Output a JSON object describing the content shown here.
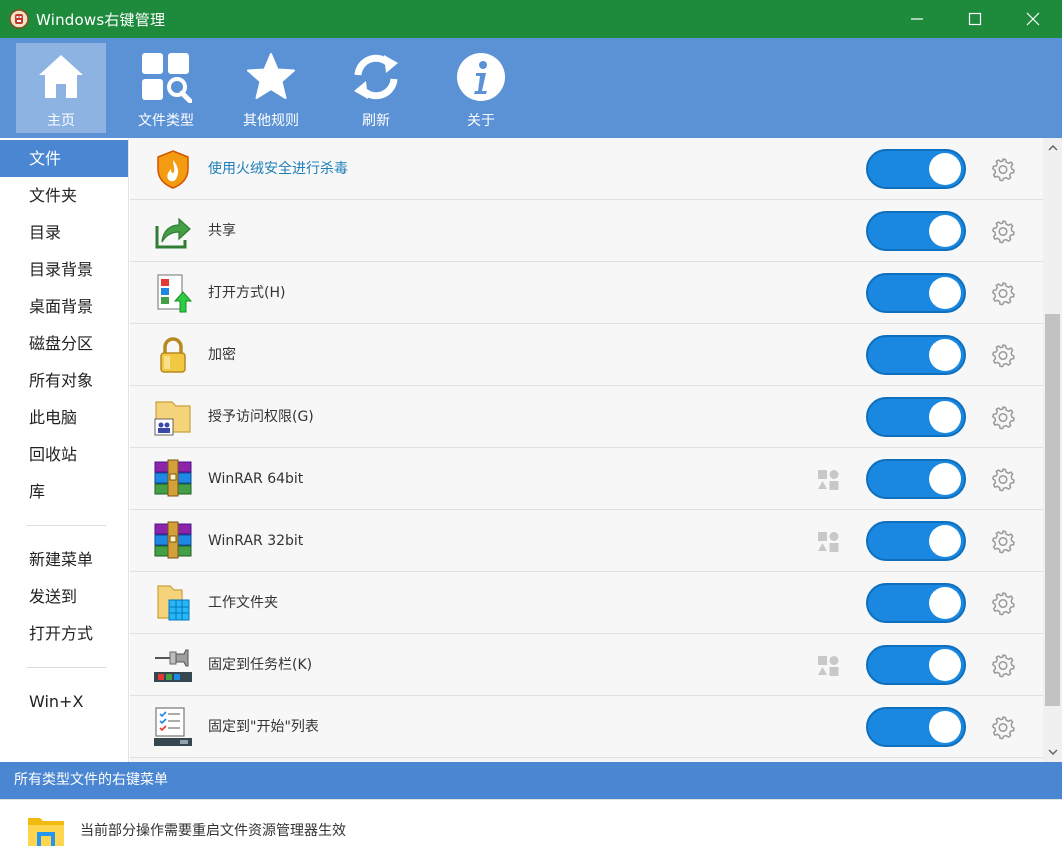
{
  "window": {
    "title": "Windows右键管理",
    "icon": "app-icon"
  },
  "toolbar": {
    "items": [
      {
        "label": "主页",
        "icon": "home-icon",
        "active": true
      },
      {
        "label": "文件类型",
        "icon": "file-types-icon",
        "active": false
      },
      {
        "label": "其他规则",
        "icon": "star-icon",
        "active": false
      },
      {
        "label": "刷新",
        "icon": "refresh-icon",
        "active": false
      },
      {
        "label": "关于",
        "icon": "info-icon",
        "active": false
      }
    ]
  },
  "sidebar": {
    "items": [
      {
        "label": "文件",
        "active": true
      },
      {
        "label": "文件夹"
      },
      {
        "label": "目录"
      },
      {
        "label": "目录背景"
      },
      {
        "label": "桌面背景"
      },
      {
        "label": "磁盘分区"
      },
      {
        "label": "所有对象"
      },
      {
        "label": "此电脑"
      },
      {
        "label": "回收站"
      },
      {
        "label": "库"
      }
    ],
    "items2": [
      {
        "label": "新建菜单"
      },
      {
        "label": "发送到"
      },
      {
        "label": "打开方式"
      }
    ],
    "items3": [
      {
        "label": "Win+X"
      }
    ]
  },
  "list": {
    "rows": [
      {
        "label": "使用火绒安全进行杀毒",
        "icon": "huorong-shield-icon",
        "enabled": true,
        "link": true
      },
      {
        "label": "共享",
        "icon": "share-arrow-icon",
        "enabled": true
      },
      {
        "label": "打开方式(H)",
        "icon": "open-with-icon",
        "enabled": true
      },
      {
        "label": "加密",
        "icon": "padlock-icon",
        "enabled": true
      },
      {
        "label": "授予访问权限(G)",
        "icon": "grant-access-icon",
        "enabled": true
      },
      {
        "label": "WinRAR 64bit",
        "icon": "winrar-books-icon",
        "enabled": true,
        "shell_ext": true
      },
      {
        "label": "WinRAR 32bit",
        "icon": "winrar-books-icon",
        "enabled": true,
        "shell_ext": true
      },
      {
        "label": "工作文件夹",
        "icon": "work-folder-icon",
        "enabled": true
      },
      {
        "label": "固定到任务栏(K)",
        "icon": "pin-taskbar-icon",
        "enabled": true,
        "shell_ext": true
      },
      {
        "label": "固定到\"开始\"列表",
        "icon": "pin-start-icon",
        "enabled": true
      }
    ]
  },
  "status": {
    "text": "所有类型文件的右键菜单"
  },
  "footer": {
    "text": "当前部分操作需要重启文件资源管理器生效",
    "icon": "explorer-folder-icon"
  },
  "colors": {
    "titlebar": "#1e8a3c",
    "toolbar": "#5b92d6",
    "accent": "#4a86d1",
    "toggle_on": "#1a88e0"
  }
}
